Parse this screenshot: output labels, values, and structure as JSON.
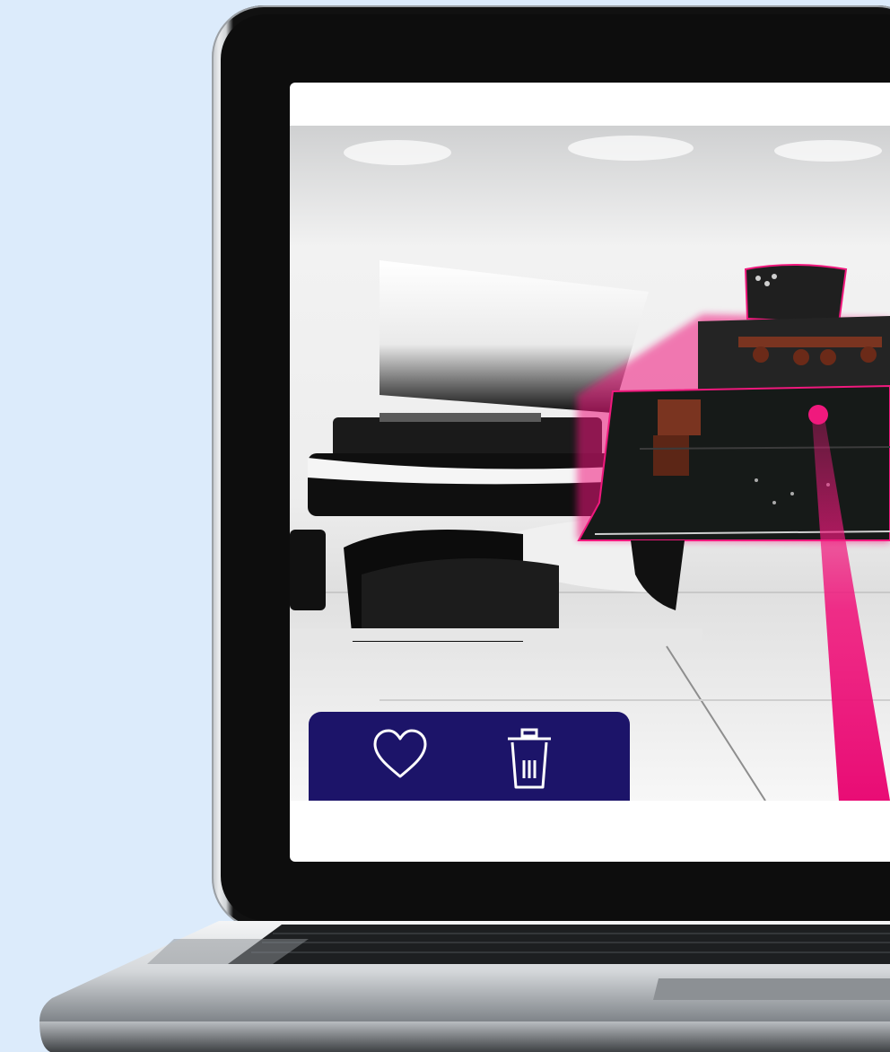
{
  "device": "laptop",
  "scene": {
    "subject": "car-model",
    "highlight_color": "#f0197d",
    "outline_color": "#e8006e"
  },
  "toolbar": {
    "background": "#1c1469",
    "icons": [
      {
        "name": "heart-icon",
        "action": "favorite"
      },
      {
        "name": "trash-icon",
        "action": "delete"
      }
    ]
  }
}
